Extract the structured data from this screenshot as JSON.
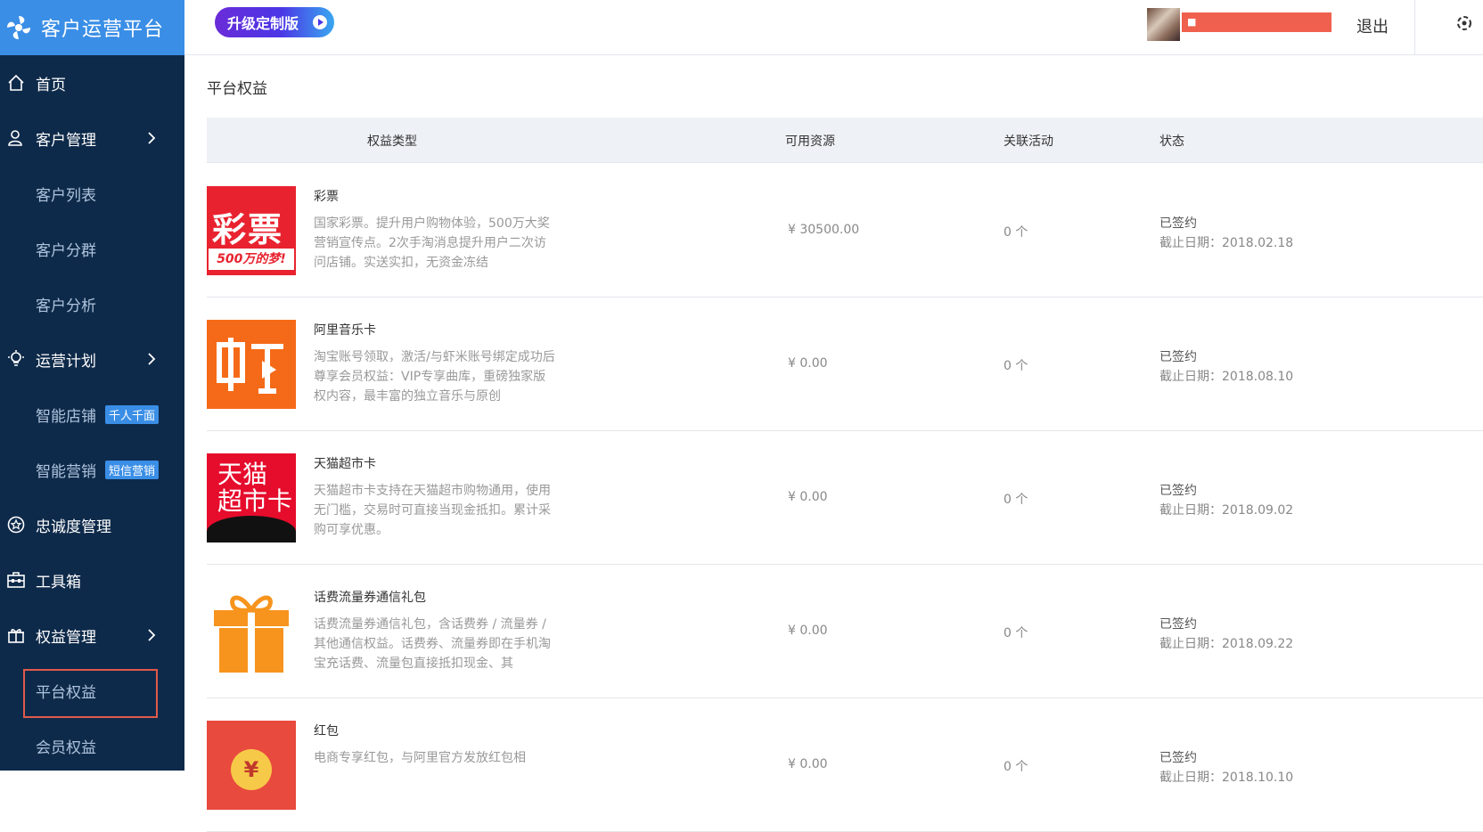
{
  "app": {
    "title": "客户运营平台",
    "upgrade_label": "升级定制版",
    "user_tag": "■",
    "logout_label": "退出"
  },
  "sidebar": {
    "items": [
      {
        "label": "首页",
        "icon": "home-icon"
      },
      {
        "label": "客户管理",
        "icon": "user-icon"
      },
      {
        "label": "客户列表"
      },
      {
        "label": "客户分群"
      },
      {
        "label": "客户分析"
      },
      {
        "label": "运营计划",
        "icon": "bulb-icon"
      },
      {
        "label": "智能店铺",
        "badge": "千人千面"
      },
      {
        "label": "智能营销",
        "badge": "短信营销"
      },
      {
        "label": "忠诚度管理",
        "icon": "star-icon"
      },
      {
        "label": "工具箱",
        "icon": "toolbox-icon"
      },
      {
        "label": "权益管理",
        "icon": "gift-icon"
      },
      {
        "label": "平台权益",
        "active": true
      },
      {
        "label": "会员权益"
      }
    ]
  },
  "main": {
    "title": "平台权益",
    "columns": {
      "type": "权益类型",
      "resource": "可用资源",
      "activity": "关联活动",
      "status": "状态"
    },
    "rows": [
      {
        "name": "彩票",
        "desc": "国家彩票。提升用户购物体验，500万大奖营销宣传点。2次手淘消息提升用户二次访问店铺。实送实扣，无资金冻结",
        "resource": "¥ 30500.00",
        "activity": "0 个",
        "status": "已签约",
        "deadline": "截止日期：2018.02.18",
        "thumb_text": "彩票",
        "thumb_sub": "500万的梦!"
      },
      {
        "name": "阿里音乐卡",
        "desc": "淘宝账号领取，激活/与虾米账号绑定成功后尊享会员权益：VIP专享曲库，重磅独家版权内容，最丰富的独立音乐与原创",
        "resource": "¥ 0.00",
        "activity": "0 个",
        "status": "已签约",
        "deadline": "截止日期：2018.08.10"
      },
      {
        "name": "天猫超市卡",
        "desc": "天猫超市卡支持在天猫超市购物通用，使用无门槛，交易时可直接当现金抵扣。累计采购可享优惠。",
        "resource": "¥ 0.00",
        "activity": "0 个",
        "status": "已签约",
        "deadline": "截止日期：2018.09.02",
        "thumb_l1": "天猫",
        "thumb_l2": "超市卡"
      },
      {
        "name": "话费流量券通信礼包",
        "desc": "话费流量券通信礼包，含话费券 / 流量券 / 其他通信权益。话费券、流量券即在手机淘宝充话费、流量包直接抵扣现金、其",
        "resource": "¥ 0.00",
        "activity": "0 个",
        "status": "已签约",
        "deadline": "截止日期：2018.09.22"
      },
      {
        "name": "红包",
        "desc": "电商专享红包，与阿里官方发放红包相",
        "resource": "¥ 0.00",
        "activity": "0 个",
        "status": "已签约",
        "deadline": "截止日期：2018.10.10",
        "thumb_coin": "¥"
      }
    ]
  }
}
